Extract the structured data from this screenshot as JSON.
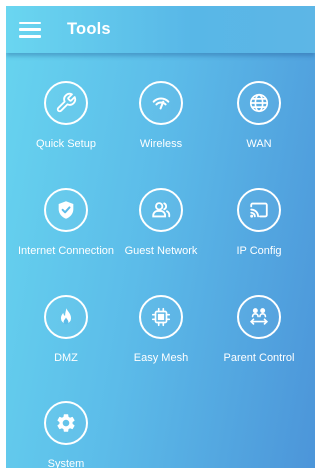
{
  "header": {
    "title": "Tools",
    "menu_icon": "hamburger-menu-icon"
  },
  "tools": [
    {
      "label": "Quick Setup",
      "icon": "wrench-icon"
    },
    {
      "label": "Wireless",
      "icon": "wifi-icon"
    },
    {
      "label": "WAN",
      "icon": "globe-icon"
    },
    {
      "label": "Internet Connection",
      "icon": "shield-check-icon"
    },
    {
      "label": "Guest Network",
      "icon": "guest-users-icon"
    },
    {
      "label": "IP Config",
      "icon": "cast-icon"
    },
    {
      "label": "DMZ",
      "icon": "flame-icon"
    },
    {
      "label": "Easy Mesh",
      "icon": "chip-icon"
    },
    {
      "label": "Parent Control",
      "icon": "parent-control-icon"
    },
    {
      "label": "System",
      "icon": "gear-icon"
    }
  ],
  "colors": {
    "gradient_start": "#67d4ef",
    "gradient_end": "#4c95d9",
    "foreground": "#ffffff"
  }
}
